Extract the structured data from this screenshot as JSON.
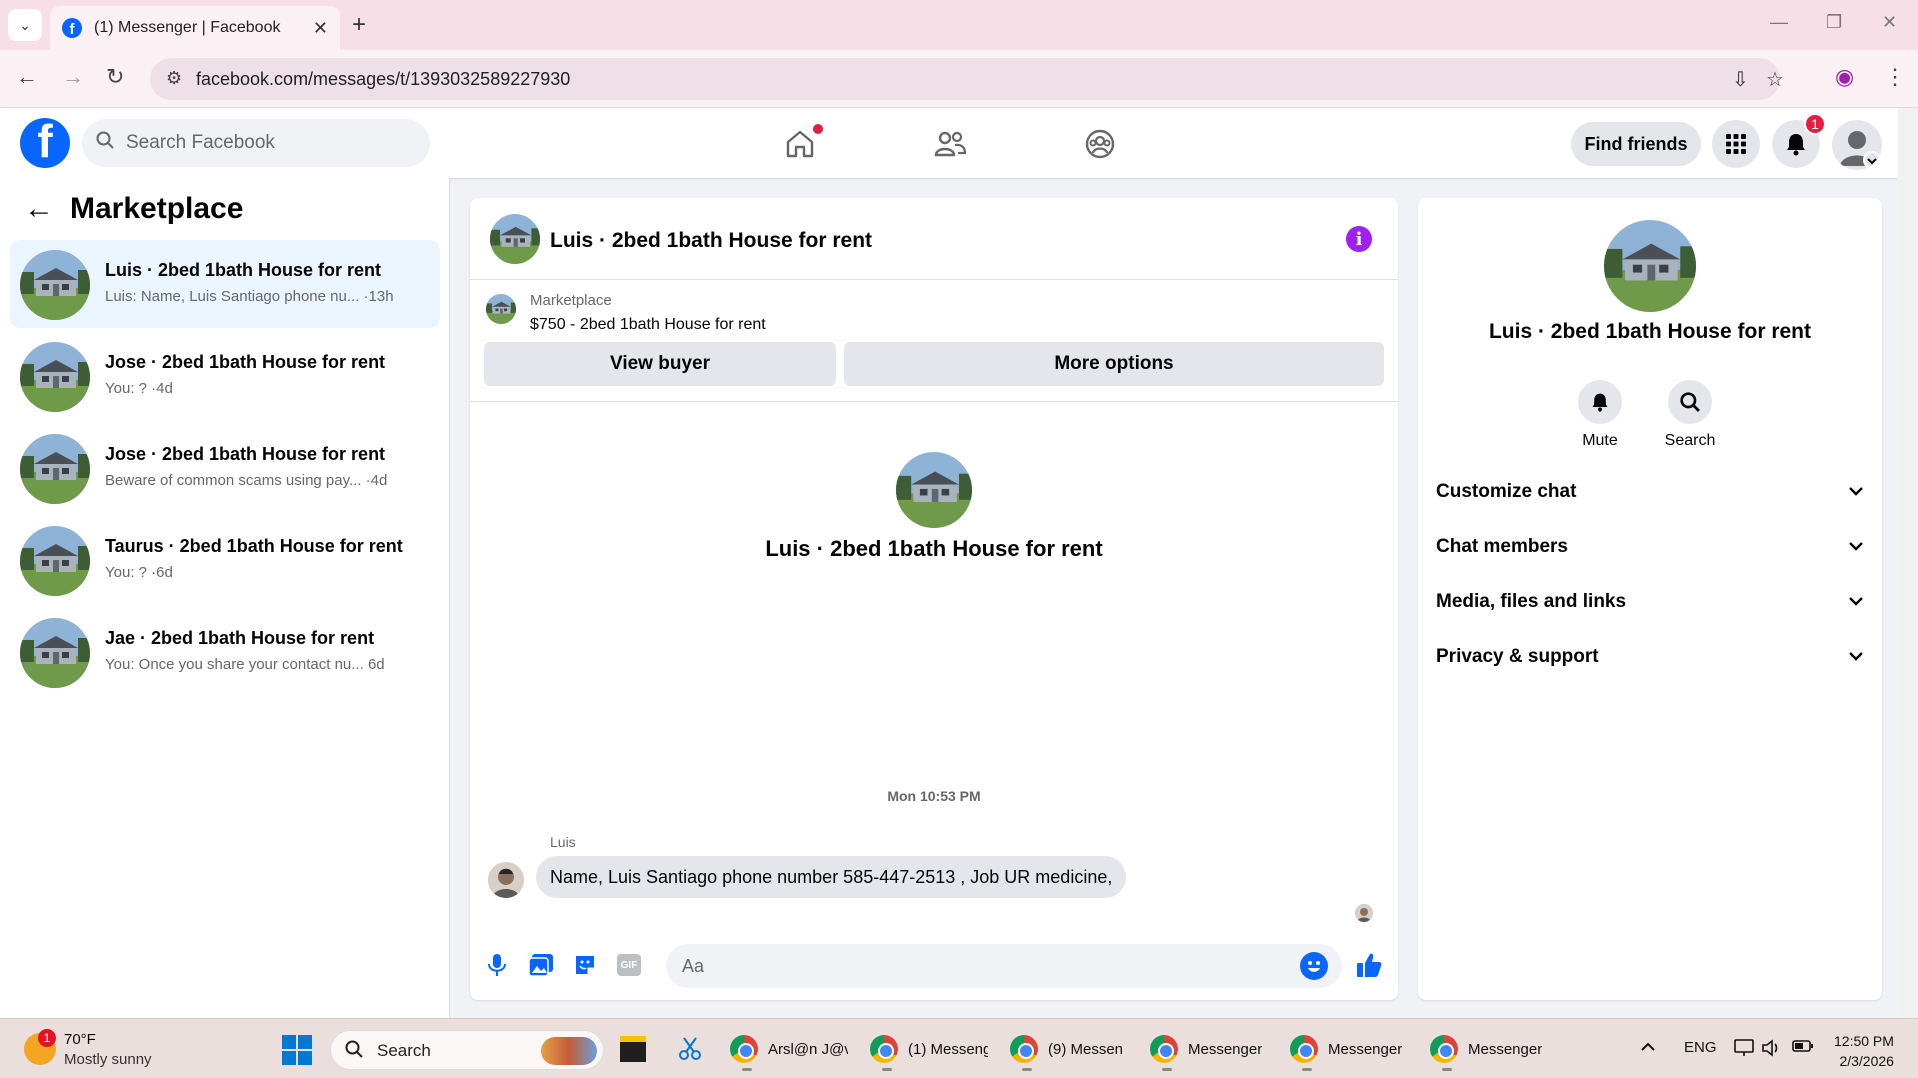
{
  "browser": {
    "tab_title": "(1) Messenger | Facebook",
    "url": "facebook.com/messages/t/1393032589227930"
  },
  "fb": {
    "logo_letter": "f",
    "search_placeholder": "Search Facebook",
    "find_friends": "Find friends",
    "notification_count": "1",
    "brand_color": "#0866ff"
  },
  "left": {
    "title": "Marketplace",
    "conversations": [
      {
        "name": "Luis · 2bed 1bath House for rent",
        "preview": "Luis: Name, Luis Santiago phone nu...",
        "time": "·13h"
      },
      {
        "name": "Jose · 2bed 1bath House for rent",
        "preview": "You: ?",
        "time": "·4d"
      },
      {
        "name": "Jose · 2bed 1bath House for rent",
        "preview": "Beware of common scams using pay...",
        "time": "·4d"
      },
      {
        "name": "Taurus · 2bed 1bath House for rent",
        "preview": "You: ?",
        "time": "·6d"
      },
      {
        "name": "Jae · 2bed 1bath House for rent",
        "preview": "You: Once you share your contact nu...",
        "time": "6d"
      }
    ]
  },
  "chat": {
    "title": "Luis · 2bed 1bath House for rent",
    "marketplace_label": "Marketplace",
    "listing": "$750 - 2bed 1bath House for rent",
    "view_buyer": "View buyer",
    "more_options": "More options",
    "hero_name": "Luis · 2bed 1bath House for rent",
    "timestamp": "Mon 10:53 PM",
    "sender": "Luis",
    "message": "Name, Luis Santiago phone number 585-447-2513 , Job UR medicine,",
    "composer_placeholder": "Aa",
    "gif_label": "GIF"
  },
  "details": {
    "name": "Luis · 2bed 1bath House for rent",
    "mute": "Mute",
    "search": "Search",
    "rows": [
      "Customize chat",
      "Chat members",
      "Media, files and links",
      "Privacy & support"
    ]
  },
  "taskbar": {
    "temp": "70°F",
    "condition": "Mostly sunny",
    "weather_badge": "1",
    "search": "Search",
    "apps": [
      "Arsl@n J@v",
      "(1) Messeng",
      "(9) Messen",
      "Messenger",
      "Messenger",
      "Messenger"
    ],
    "lang": "ENG",
    "time": "12:50 PM",
    "date": "2/3/2026"
  }
}
